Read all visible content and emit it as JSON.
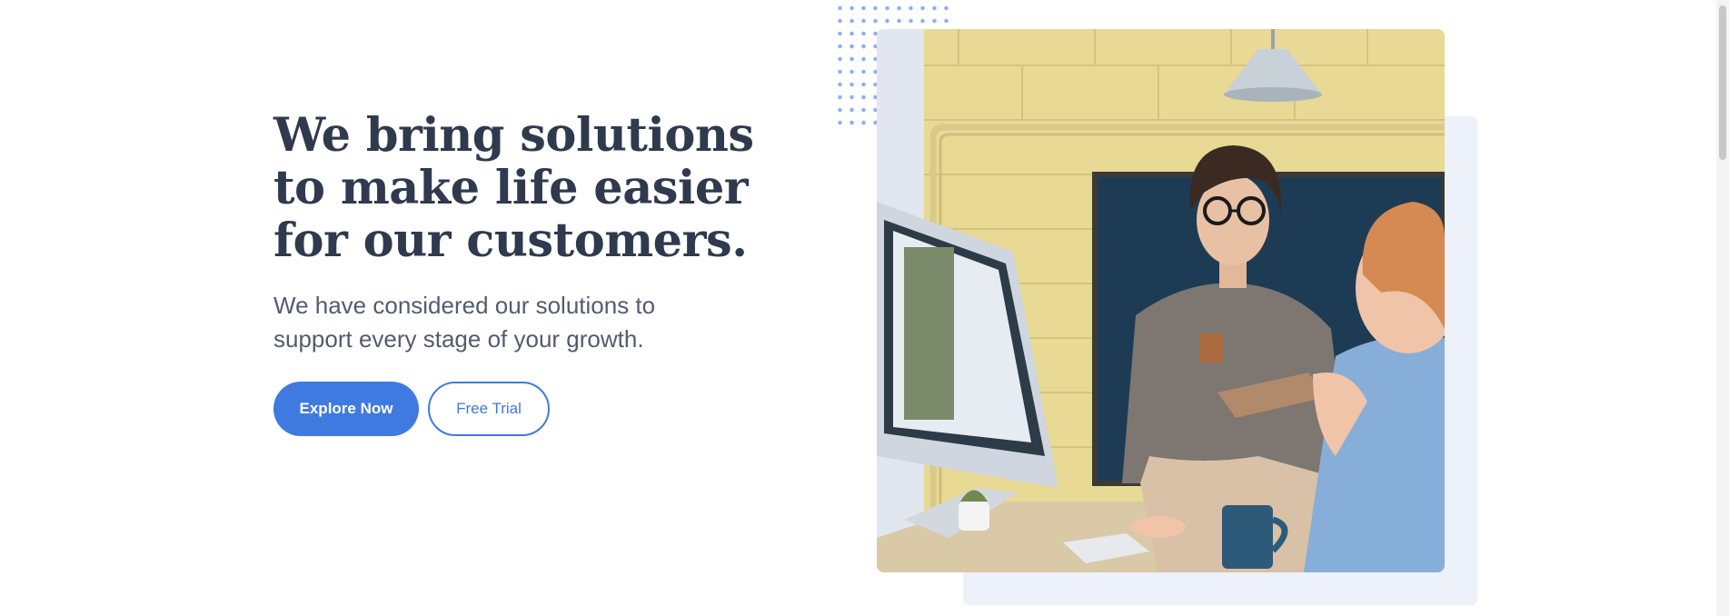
{
  "hero": {
    "title": "We bring solutions to make life easier for our customers.",
    "subtitle": "We have considered our solutions to support every stage of your growth.",
    "primary_button": "Explore Now",
    "secondary_button": "Free Trial"
  },
  "image": {
    "alt": "Two colleagues talking in an office next to a computer"
  },
  "colors": {
    "accent": "#3f7ae0",
    "heading": "#2f3a4f",
    "body_text": "#525c6e",
    "panel": "#edf1fa",
    "dots": "#8fb0ec"
  }
}
